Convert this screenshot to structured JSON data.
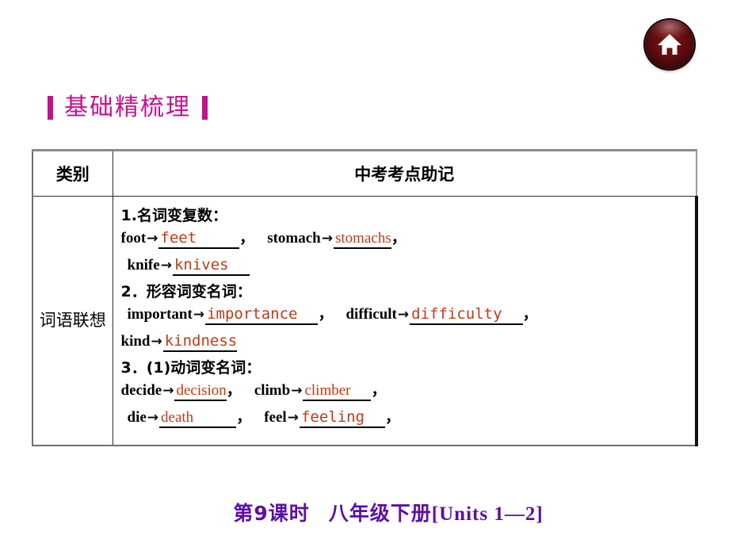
{
  "home_button": {
    "icon": "home-icon",
    "color": "#5d0c0e"
  },
  "section": {
    "title": "基础精梳理",
    "accent_color": "#c4128e"
  },
  "table": {
    "header": {
      "category": "类别",
      "main": "中考考点助记"
    },
    "row": {
      "category_label": "词语联想",
      "groups": [
        {
          "heading": "1.名词变复数：",
          "lines": [
            {
              "indent": false,
              "items": [
                {
                  "term": "foot",
                  "answer": "feet",
                  "answer_style": "mono",
                  "pad": "wide",
                  "trailing": "，"
                },
                {
                  "term": "stomach",
                  "answer": "stomachs",
                  "answer_style": "serif",
                  "pad": "none",
                  "trailing": "，"
                }
              ]
            },
            {
              "indent": true,
              "items": [
                {
                  "term": "knife",
                  "answer": "knives",
                  "answer_style": "mono",
                  "pad": "narrow",
                  "trailing": ""
                }
              ]
            }
          ]
        },
        {
          "heading": "2．形容词变名词：",
          "lines": [
            {
              "indent": true,
              "items": [
                {
                  "term": "important",
                  "answer": "importance",
                  "answer_style": "mono",
                  "pad": "narrow",
                  "trailing": "，"
                },
                {
                  "term": "difficult",
                  "answer": "difficulty",
                  "answer_style": "mono",
                  "pad": "narrow",
                  "trailing": "，"
                }
              ]
            },
            {
              "indent": false,
              "items": [
                {
                  "term": "kind",
                  "answer": "kindness",
                  "answer_style": "mono",
                  "pad": "none",
                  "trailing": ""
                }
              ]
            }
          ]
        },
        {
          "heading": "3．(1)动词变名词：",
          "lines": [
            {
              "indent": false,
              "items": [
                {
                  "term": "decide",
                  "answer": "decision",
                  "answer_style": "serif",
                  "pad": "none",
                  "trailing": "，"
                },
                {
                  "term": "climb",
                  "answer": "climber",
                  "answer_style": "serif",
                  "pad": "narrow",
                  "trailing": "，"
                }
              ]
            },
            {
              "indent": true,
              "items": [
                {
                  "term": "die",
                  "answer": "death",
                  "answer_style": "serif",
                  "pad": "wide",
                  "trailing": "，"
                },
                {
                  "term": "feel",
                  "answer": "feeling",
                  "answer_style": "mono",
                  "pad": "narrow",
                  "trailing": "，"
                }
              ]
            }
          ]
        }
      ]
    }
  },
  "footer": {
    "lesson": "第9课时",
    "book": "八年级下册",
    "units": "[Units 1—2]",
    "color": "#5b0fa8"
  }
}
